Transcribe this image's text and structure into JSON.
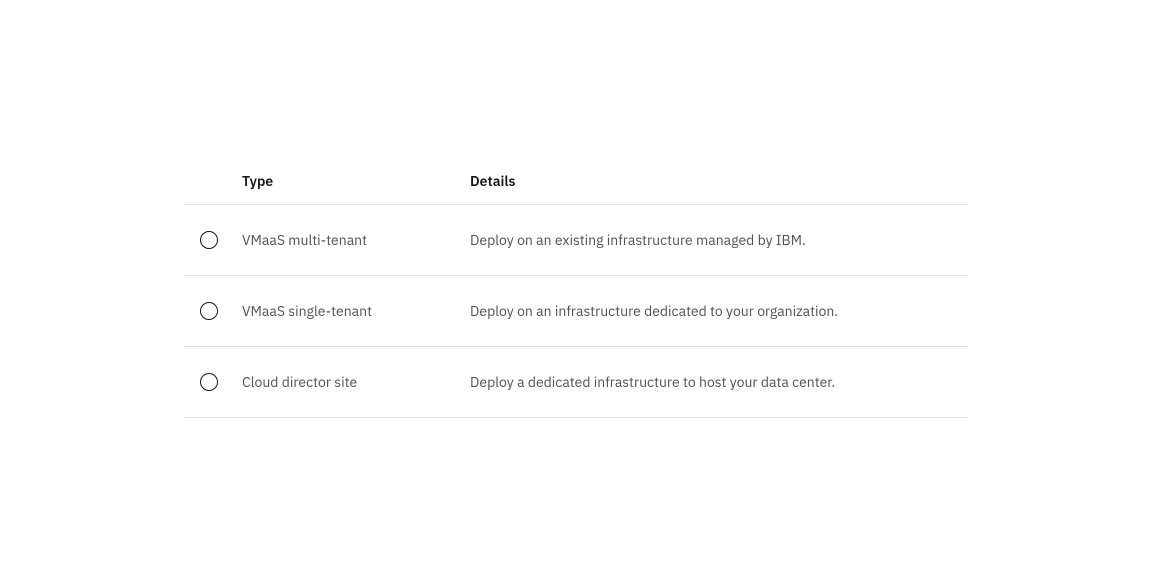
{
  "table": {
    "headers": {
      "type": "Type",
      "details": "Details"
    },
    "rows": [
      {
        "type": "VMaaS multi-tenant",
        "details": "Deploy on an existing infrastructure managed by IBM.",
        "selected": false
      },
      {
        "type": "VMaaS single-tenant",
        "details": "Deploy on an infrastructure dedicated to your organization.",
        "selected": false
      },
      {
        "type": "Cloud director site",
        "details": "Deploy a dedicated infrastructure to host your data center.",
        "selected": false
      }
    ]
  }
}
